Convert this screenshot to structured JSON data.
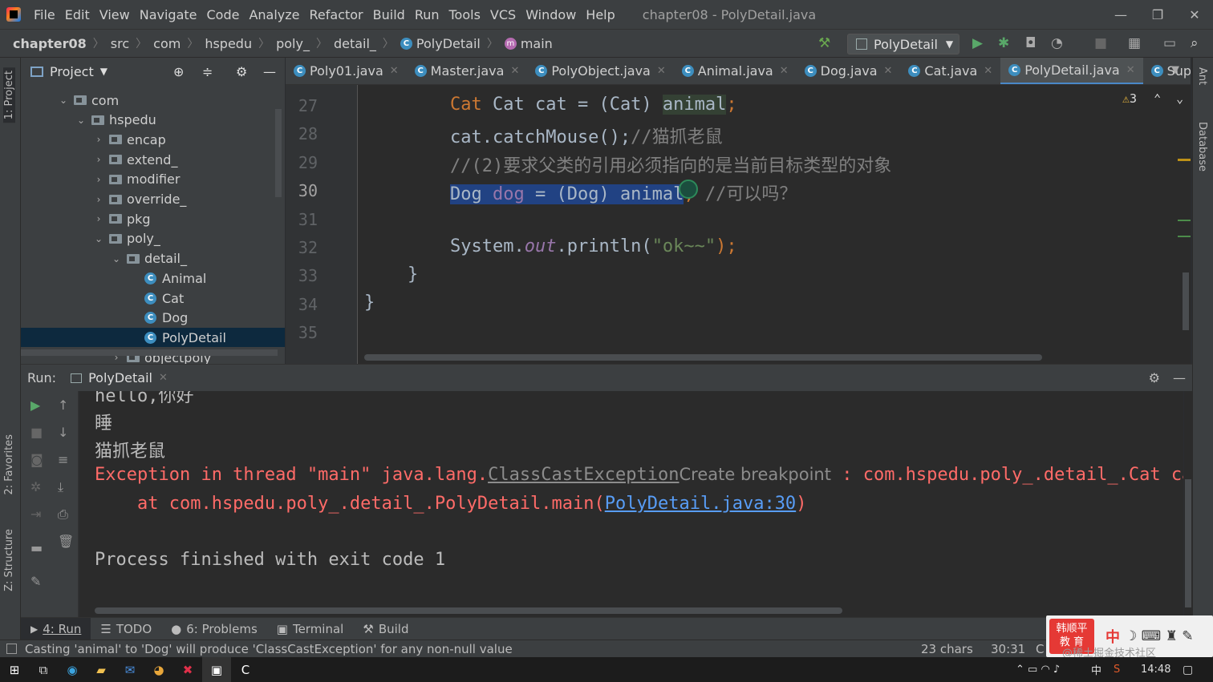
{
  "app": {
    "window_title": "chapter08 - PolyDetail.java",
    "menu": [
      "File",
      "Edit",
      "View",
      "Navigate",
      "Code",
      "Analyze",
      "Refactor",
      "Build",
      "Run",
      "Tools",
      "VCS",
      "Window",
      "Help"
    ]
  },
  "breadcrumb": [
    "chapter08",
    "src",
    "com",
    "hspedu",
    "poly_",
    "detail_",
    "PolyDetail",
    "main"
  ],
  "run_config": "PolyDetail",
  "left_tool_tabs": [
    "1: Project",
    "2: Favorites",
    "Z: Structure"
  ],
  "right_tool_tabs": [
    "Ant",
    "Database"
  ],
  "project_panel": {
    "title": "Project",
    "tree": [
      {
        "label": "com",
        "depth": 0,
        "kind": "folder",
        "expanded": true
      },
      {
        "label": "hspedu",
        "depth": 1,
        "kind": "folder",
        "expanded": true
      },
      {
        "label": "encap",
        "depth": 2,
        "kind": "folder",
        "expanded": false
      },
      {
        "label": "extend_",
        "depth": 2,
        "kind": "folder",
        "expanded": false
      },
      {
        "label": "modifier",
        "depth": 2,
        "kind": "folder",
        "expanded": false
      },
      {
        "label": "override_",
        "depth": 2,
        "kind": "folder",
        "expanded": false
      },
      {
        "label": "pkg",
        "depth": 2,
        "kind": "folder",
        "expanded": false
      },
      {
        "label": "poly_",
        "depth": 2,
        "kind": "folder",
        "expanded": true
      },
      {
        "label": "detail_",
        "depth": 3,
        "kind": "folder",
        "expanded": true
      },
      {
        "label": "Animal",
        "depth": 4,
        "kind": "class"
      },
      {
        "label": "Cat",
        "depth": 4,
        "kind": "class"
      },
      {
        "label": "Dog",
        "depth": 4,
        "kind": "class"
      },
      {
        "label": "PolyDetail",
        "depth": 4,
        "kind": "class",
        "selected": true
      },
      {
        "label": "objectpoly",
        "depth": 3,
        "kind": "folder",
        "expanded": false
      }
    ]
  },
  "editor_tabs": [
    {
      "label": "Poly01.java"
    },
    {
      "label": "Master.java"
    },
    {
      "label": "PolyObject.java"
    },
    {
      "label": "Animal.java"
    },
    {
      "label": "Dog.java"
    },
    {
      "label": "Cat.java"
    },
    {
      "label": "PolyDetail.java",
      "active": true
    },
    {
      "label": "Supe"
    }
  ],
  "editor": {
    "warning_count": "3",
    "line_numbers": [
      "27",
      "28",
      "29",
      "30",
      "31",
      "32",
      "33",
      "34",
      "35"
    ],
    "current_line": "30",
    "code": {
      "l27": {
        "a": "Cat cat = (Cat) ",
        "b": "animal",
        ";": ";"
      },
      "l28": {
        "a": "cat.catchMouse();",
        "c": "//猫抓老鼠"
      },
      "l29": {
        "c": "//(2)要求父类的引用必须指向的是当前目标类型的对象"
      },
      "l30": {
        "t1": "Dog ",
        "t2": "dog",
        "t3": " = (Dog) anima",
        "t4": "l",
        "t5": "; ",
        "c": "//可以吗？"
      },
      "l32": {
        "a": "System.",
        "f": "out",
        "b": ".println(",
        "s": "\"ok~~\"",
        "e": ");"
      },
      "l33": "}",
      "l34": "}"
    }
  },
  "run_panel": {
    "label": "Run:",
    "tab": "PolyDetail",
    "console": {
      "line0": "hello,你好",
      "line1": "睡",
      "line2": "猫抓老鼠",
      "exc_a": "Exception in thread \"main\" java.lang.",
      "exc_link": "ClassCastException",
      "exc_hint": "Create breakpoint",
      "exc_b": " : com.hspedu.poly_.detail_.Cat ca",
      "at_a": "    at com.hspedu.poly_.detail_.PolyDetail.main(",
      "at_link": "PolyDetail.java:30",
      "at_b": ")",
      "finish": "Process finished with exit code 1"
    }
  },
  "tool_tabs": [
    {
      "label": "4: Run",
      "active": true
    },
    {
      "label": "TODO"
    },
    {
      "label": "6: Problems"
    },
    {
      "label": "Terminal"
    },
    {
      "label": "Build"
    }
  ],
  "status": {
    "message": "Casting 'animal' to 'Dog' will produce 'ClassCastException' for any non-null value",
    "chars": "23 chars",
    "position": "30:31",
    "extra": "C"
  },
  "taskbar": {
    "time": "14:48",
    "ime": "中"
  },
  "watermark": {
    "logo_line1": "韩顺平",
    "logo_line2": "教 育",
    "ime": "中",
    "text": "@稀土掘金技术社区"
  }
}
